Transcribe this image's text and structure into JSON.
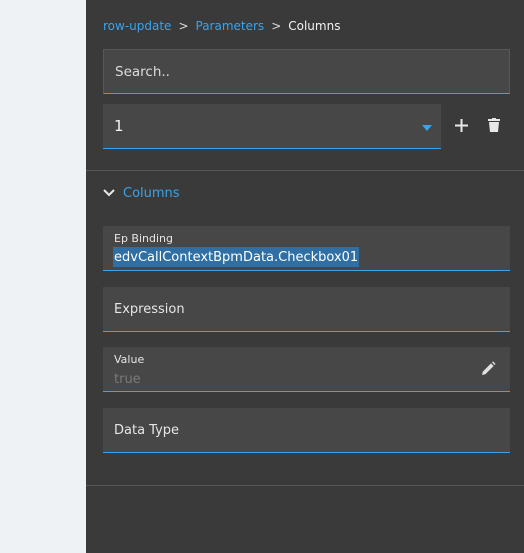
{
  "breadcrumb": {
    "items": [
      "row-update",
      "Parameters"
    ],
    "separator": ">",
    "current": "Columns"
  },
  "search": {
    "placeholder": "Search.."
  },
  "selector": {
    "value": "1"
  },
  "icons": {
    "add": "plus-icon",
    "delete": "trash-icon",
    "collapse": "chevron-down-icon",
    "edit": "pencil-icon"
  },
  "section": {
    "title": "Columns"
  },
  "fields": {
    "ep_binding": {
      "label": "Ep Binding",
      "value": "edvCallContextBpmData.Checkbox01"
    },
    "expression": {
      "label": "Expression"
    },
    "value": {
      "label": "Value",
      "value": "true"
    },
    "data_type": {
      "label": "Data Type"
    }
  },
  "colors": {
    "accent": "#3aa3ea",
    "panel_bg": "#3a3a3a",
    "field_bg": "#474747",
    "page_bg": "#eef2f5",
    "selection": "#2f6fa3"
  }
}
